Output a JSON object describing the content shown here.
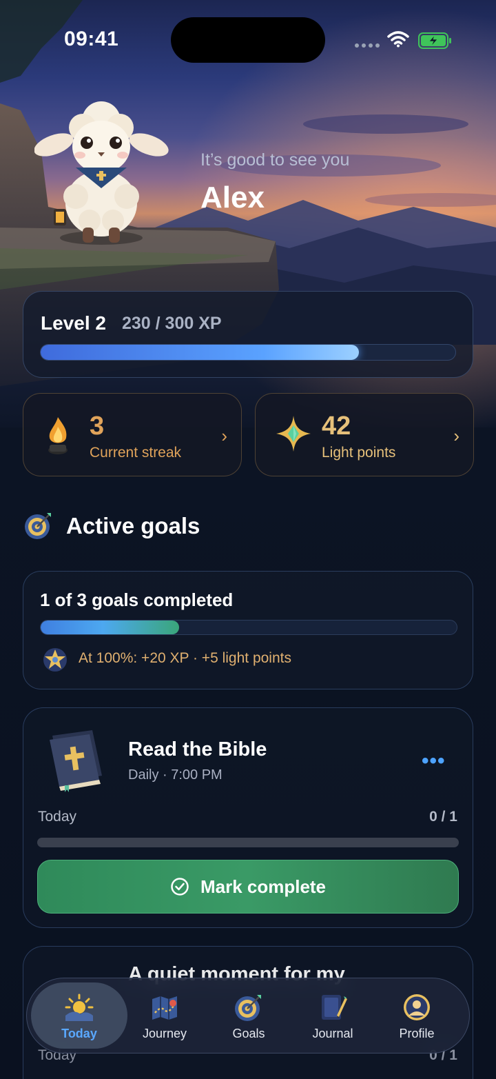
{
  "status_bar": {
    "time": "09:41"
  },
  "greeting": {
    "subtitle": "It’s good to see you",
    "name": "Alex"
  },
  "level": {
    "label": "Level 2",
    "xp_text": "230 / 300 XP",
    "progress": 0.767
  },
  "stats": {
    "streak": {
      "value": "3",
      "label": "Current streak",
      "icon": "flame-icon"
    },
    "light": {
      "value": "42",
      "label": "Light points",
      "icon": "sparkle-gem-icon"
    }
  },
  "section": {
    "title": "Active goals",
    "icon": "target-icon"
  },
  "summary": {
    "title": "1 of 3 goals completed",
    "progress": 0.333,
    "reward": "At 100%: +20 XP · +5 light points"
  },
  "goal": {
    "title": "Read the Bible",
    "subtitle": "Daily · 7:00 PM",
    "period": "Today",
    "count": "0 / 1",
    "progress": 0,
    "more": "•••",
    "button": "Mark complete"
  },
  "goal2": {
    "title": "A quiet moment for my",
    "period": "Today",
    "count": "0 / 1"
  },
  "tabs": [
    {
      "label": "Today",
      "icon": "sunrise-icon",
      "active": true
    },
    {
      "label": "Journey",
      "icon": "map-icon",
      "active": false
    },
    {
      "label": "Goals",
      "icon": "target-icon",
      "active": false
    },
    {
      "label": "Journal",
      "icon": "journal-icon",
      "active": false
    },
    {
      "label": "Profile",
      "icon": "profile-icon",
      "active": false
    }
  ],
  "colors": {
    "accent_blue": "#5aa8ff",
    "streak_orange": "#e0a35a",
    "light_gold": "#e6c07a",
    "complete_green": "#3a9a66"
  }
}
